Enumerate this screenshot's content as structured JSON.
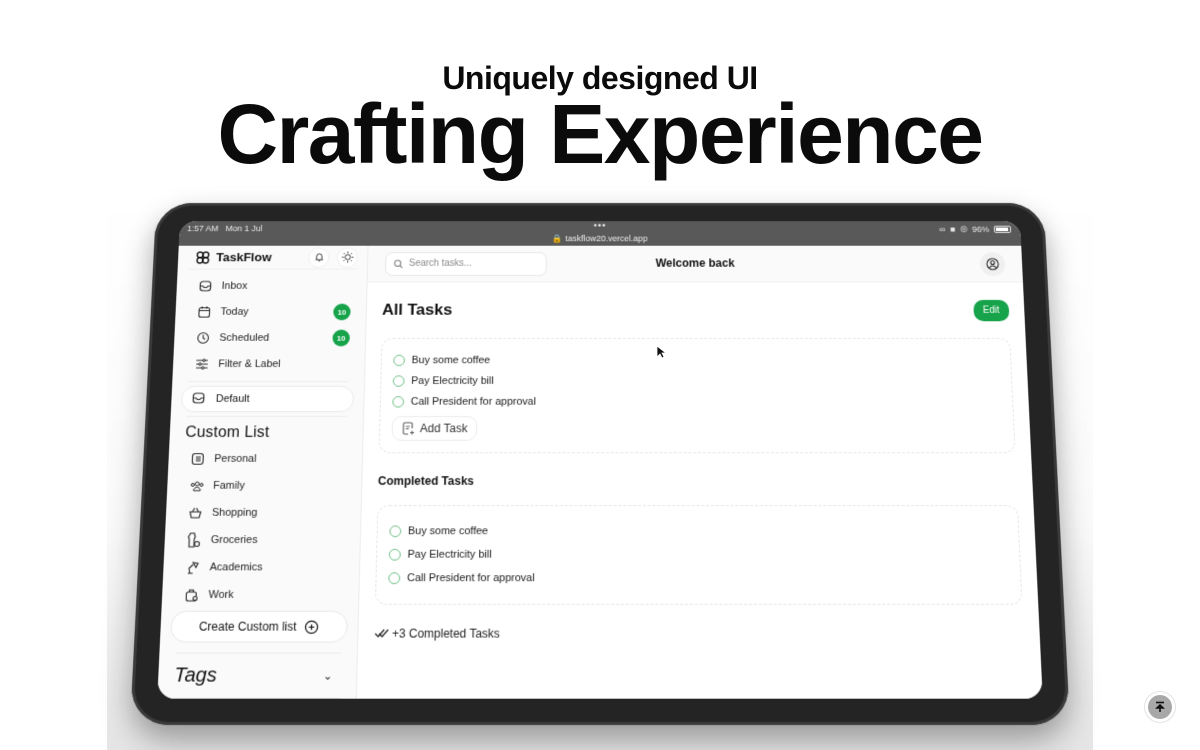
{
  "hero": {
    "subtitle": "Uniquely designed UI",
    "title": "Crafting Experience"
  },
  "statusbar": {
    "time": "1:57 AM",
    "date": "Mon 1 Jul",
    "dots": "•••",
    "url": "taskflow20.vercel.app",
    "battery": "96%"
  },
  "sidebar": {
    "brand": "TaskFlow",
    "nav": [
      {
        "label": "Inbox",
        "icon": "inbox-icon",
        "badge": null
      },
      {
        "label": "Today",
        "icon": "calendar-icon",
        "badge": "10"
      },
      {
        "label": "Scheduled",
        "icon": "clock-icon",
        "badge": "10"
      },
      {
        "label": "Filter & Label",
        "icon": "sliders-icon",
        "badge": null
      }
    ],
    "default_list": "Default",
    "custom_list_title": "Custom List",
    "custom_lists": [
      {
        "label": "Personal",
        "icon": "list-icon"
      },
      {
        "label": "Family",
        "icon": "users-icon"
      },
      {
        "label": "Shopping",
        "icon": "basket-icon"
      },
      {
        "label": "Groceries",
        "icon": "groceries-icon"
      },
      {
        "label": "Academics",
        "icon": "lamp-icon"
      },
      {
        "label": "Work",
        "icon": "briefcase-icon"
      }
    ],
    "create_label": "Create Custom list",
    "tags_label": "Tags"
  },
  "topbar": {
    "search_placeholder": "Search tasks...",
    "welcome": "Welcome back"
  },
  "main": {
    "title": "All Tasks",
    "edit_label": "Edit",
    "tasks": [
      "Buy some coffee",
      "Pay Electricity bill",
      "Call President for approval"
    ],
    "add_task_label": "Add Task",
    "completed_title": "Completed Tasks",
    "completed_tasks": [
      "Buy some coffee",
      "Pay Electricity bill",
      "Call President for approval"
    ],
    "more_completed": "+3 Completed Tasks"
  },
  "colors": {
    "accent": "#16a34a",
    "checkbox": "#6fbf86",
    "frame": "#242424"
  }
}
